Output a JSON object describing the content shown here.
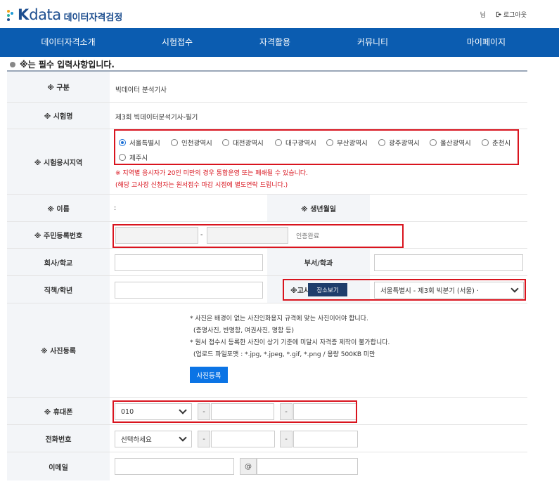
{
  "header": {
    "logo_text": "data",
    "logo_subtitle": "데이터자격검정",
    "user_suffix": "님",
    "logout_label": "로그아웃"
  },
  "nav": {
    "items": [
      {
        "label": "데이터자격소개"
      },
      {
        "label": "시험접수"
      },
      {
        "label": "자격활용"
      },
      {
        "label": "커뮤니티"
      },
      {
        "label": "마이페이지"
      }
    ]
  },
  "form": {
    "required_note": "※는 필수 입력사항입니다.",
    "category": {
      "label": "※ 구분",
      "value": "빅데이터 분석기사"
    },
    "exam_name": {
      "label": "※ 시험명",
      "value": "제3회 빅데이터분석기사-필기"
    },
    "region": {
      "label": "※ 시험응시지역",
      "options": [
        "서울특별시",
        "인천광역시",
        "대전광역시",
        "대구광역시",
        "부산광역시",
        "광주광역시",
        "울산광역시",
        "춘천시",
        "제주시"
      ],
      "selected": "서울특별시",
      "notice1": "※ 지역별 응시자가 20인 미만의 경우 통합운영 또는 폐쇄될 수 있습니다.",
      "notice2": "(해당 고사장 신청자는 원서접수 마감 시점에 별도연락 드립니다.)"
    },
    "name": {
      "label": "※ 이름",
      "value": ":"
    },
    "birth": {
      "label": "※ 생년월일",
      "value": ""
    },
    "resident_id": {
      "label": "※ 주민등록번호",
      "separator": "-",
      "status": "인증완료"
    },
    "company": {
      "label": "회사/학교",
      "value": ""
    },
    "department": {
      "label": "부서/학과",
      "value": ""
    },
    "position": {
      "label": "직책/학년",
      "value": ""
    },
    "venue": {
      "label": "※고사장",
      "button": "장소보기",
      "selected": "서울특별시 - 제3회 빅분기 (서울) ·"
    },
    "photo": {
      "label": "※ 사진등록",
      "lines": [
        "* 사진은 배경이 없는 사진인화용지 규격에 맞는 사진이어야 합니다.",
        "(증명사진, 반명함, 여권사진, 명함 등)",
        "* 원서 접수시 등록한 사진이 상기 기준에 미달시 자격증 제작이 불가합니다.",
        "(업로드 파일포맷 : *.jpg, *.jpeg, *.gif, *.png / 용량 500KB 미만"
      ],
      "button": "사진등록"
    },
    "mobile": {
      "label": "※ 휴대폰",
      "prefix": "010",
      "separator": "-"
    },
    "phone": {
      "label": "전화번호",
      "prefix": "선택하세요",
      "separator": "-"
    },
    "email": {
      "label": "이메일",
      "at": "@"
    }
  },
  "colors": {
    "nav_bg": "#0b5cb0",
    "brand": "#1d4e8f",
    "highlight_box": "#d9141e",
    "primary_button": "#0b74e5",
    "label_bg": "#f3f5f8"
  }
}
